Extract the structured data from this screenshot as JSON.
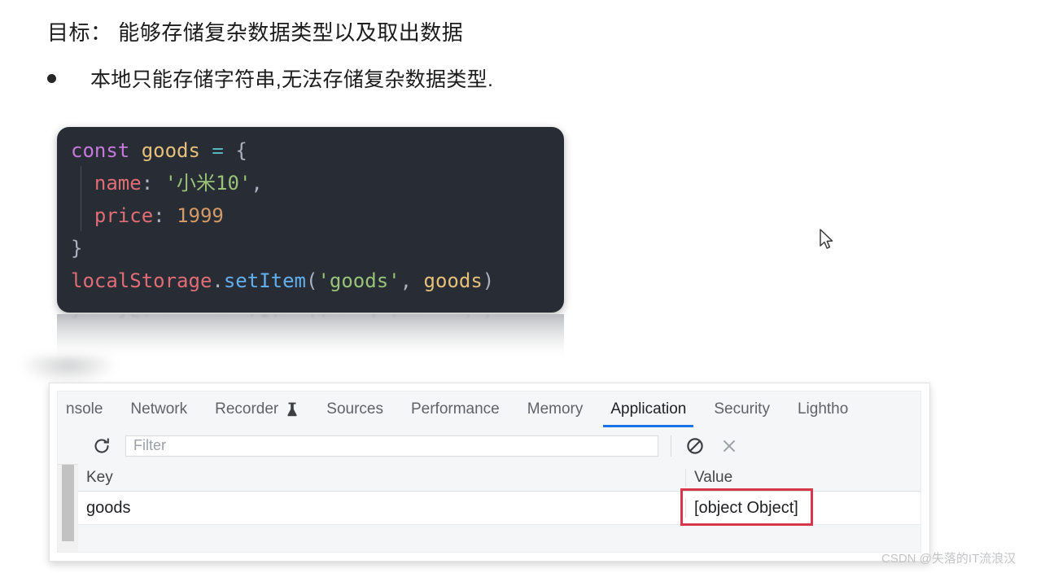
{
  "slide": {
    "goal_line": "目标： 能够存储复杂数据类型以及取出数据",
    "bullet": "本地只能存储字符串,无法存储复杂数据类型."
  },
  "code": {
    "language": "javascript",
    "background": "#282c34",
    "lines": [
      {
        "tokens": [
          {
            "t": "const",
            "c": "keyword"
          },
          {
            "t": " ",
            "c": "plain"
          },
          {
            "t": "goods",
            "c": "variable"
          },
          {
            "t": " ",
            "c": "plain"
          },
          {
            "t": "=",
            "c": "operator"
          },
          {
            "t": " ",
            "c": "plain"
          },
          {
            "t": "{",
            "c": "punctuation"
          }
        ]
      },
      {
        "tokens": [
          {
            "t": "  ",
            "c": "plain"
          },
          {
            "t": "name",
            "c": "property"
          },
          {
            "t": ":",
            "c": "punctuation"
          },
          {
            "t": " ",
            "c": "plain"
          },
          {
            "t": "'小米10'",
            "c": "string"
          },
          {
            "t": ",",
            "c": "punctuation"
          }
        ]
      },
      {
        "tokens": [
          {
            "t": "  ",
            "c": "plain"
          },
          {
            "t": "price",
            "c": "property"
          },
          {
            "t": ":",
            "c": "punctuation"
          },
          {
            "t": " ",
            "c": "plain"
          },
          {
            "t": "1999",
            "c": "number"
          }
        ]
      },
      {
        "tokens": [
          {
            "t": "}",
            "c": "punctuation"
          }
        ]
      },
      {
        "tokens": [
          {
            "t": "localStorage",
            "c": "object"
          },
          {
            "t": ".",
            "c": "punctuation"
          },
          {
            "t": "setItem",
            "c": "function"
          },
          {
            "t": "(",
            "c": "punctuation"
          },
          {
            "t": "'goods'",
            "c": "string"
          },
          {
            "t": ",",
            "c": "punctuation"
          },
          {
            "t": " ",
            "c": "plain"
          },
          {
            "t": "goods",
            "c": "variable"
          },
          {
            "t": ")",
            "c": "punctuation"
          }
        ]
      }
    ],
    "reflection_line": "localStorage.setItem('goods', goods)",
    "colors": {
      "keyword": "#c678dd",
      "variable": "#e5c07b",
      "operator": "#56b6c2",
      "punctuation": "#abb2bf",
      "property": "#e06c75",
      "string": "#98c379",
      "number": "#d19a66",
      "function": "#61afef",
      "object": "#e06c75"
    }
  },
  "devtools": {
    "tabs": [
      {
        "label": "nsole",
        "active": false,
        "clipped": true,
        "icon": null
      },
      {
        "label": "Network",
        "active": false,
        "clipped": false,
        "icon": null
      },
      {
        "label": "Recorder",
        "active": false,
        "clipped": false,
        "icon": "flask-icon"
      },
      {
        "label": "Sources",
        "active": false,
        "clipped": false,
        "icon": null
      },
      {
        "label": "Performance",
        "active": false,
        "clipped": false,
        "icon": null
      },
      {
        "label": "Memory",
        "active": false,
        "clipped": false,
        "icon": null
      },
      {
        "label": "Application",
        "active": true,
        "clipped": false,
        "icon": null
      },
      {
        "label": "Security",
        "active": false,
        "clipped": false,
        "icon": null
      },
      {
        "label": "Lightho",
        "active": false,
        "clipped": true,
        "icon": null
      }
    ],
    "active_tab": "Application",
    "accent_color": "#1a73e8",
    "toolbar": {
      "refresh_icon": "refresh-icon",
      "filter_value": "",
      "filter_placeholder": "Filter",
      "clear_icon": "block-clear-icon",
      "close_icon": "close-x-icon"
    },
    "storage_table": {
      "columns": [
        "Key",
        "Value"
      ],
      "rows": [
        {
          "key": "goods",
          "value": "[object Object]"
        }
      ]
    }
  },
  "annotation": {
    "type": "red-rectangle",
    "color": "#d6374b",
    "target_text": "[object Object]"
  },
  "watermark": "CSDN @失落的IT流浪汉"
}
